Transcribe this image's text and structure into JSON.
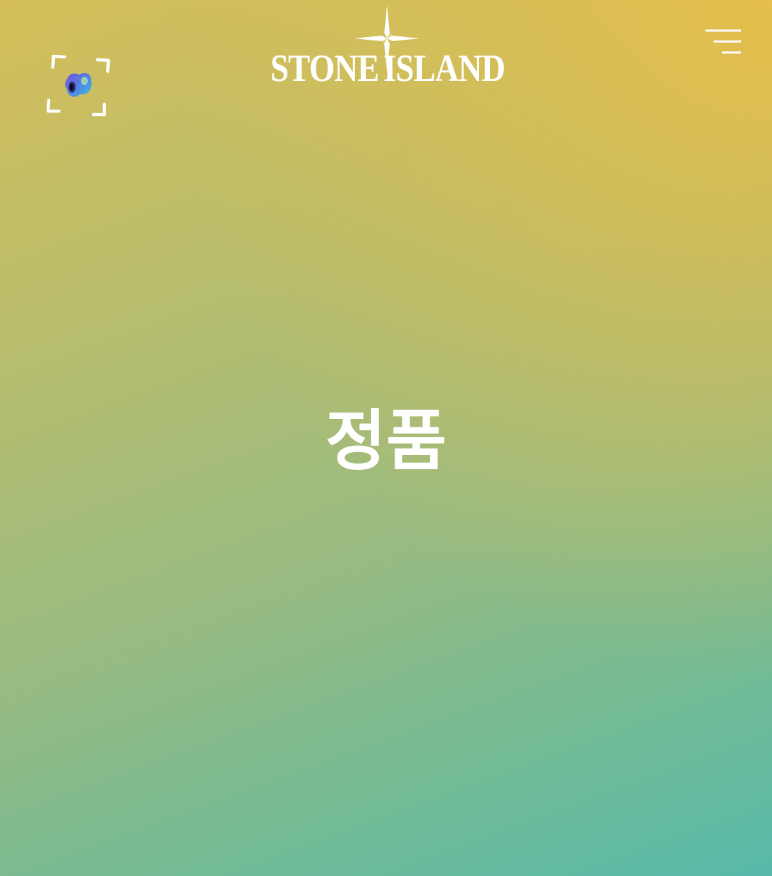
{
  "header": {
    "brand_left": "STONE",
    "brand_right": "ISLAND",
    "scan_icon": "scan-frame-icon",
    "menu_icon": "menu-icon",
    "logo_icon": "compass-rose-icon"
  },
  "main": {
    "title": "정품"
  },
  "colors": {
    "gradient_top": "#d6bf5a",
    "gradient_top_right": "#ecbe46",
    "gradient_bottom": "#57b9a9",
    "foreground": "#ffffff"
  }
}
